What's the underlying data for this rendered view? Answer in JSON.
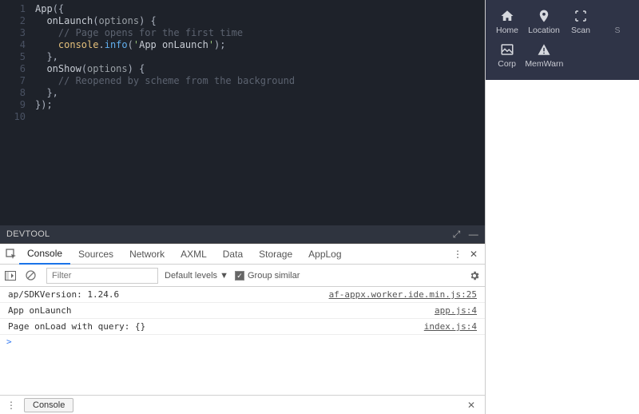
{
  "editor": {
    "lines": [
      "App({",
      "  onLaunch(options) {",
      "    // Page opens for the first time",
      "    console.info('App onLaunch');",
      "  },",
      "  onShow(options) {",
      "    // Reopened by scheme from the background",
      "  },",
      "});"
    ],
    "line_numbers": [
      "1",
      "2",
      "3",
      "4",
      "5",
      "6",
      "7",
      "8",
      "9",
      "10"
    ]
  },
  "devtool": {
    "title": "DEVTOOL",
    "tabs": [
      "Console",
      "Sources",
      "Network",
      "AXML",
      "Data",
      "Storage",
      "AppLog"
    ],
    "active_tab": "Console",
    "filter_placeholder": "Filter",
    "levels_label": "Default levels ▼",
    "group_similar_label": "Group similar",
    "logs": [
      {
        "msg": "ap/SDKVersion: 1.24.6",
        "src": "af-appx.worker.ide.min.js:25"
      },
      {
        "msg": "App onLaunch",
        "src": "app.js:4"
      },
      {
        "msg": "Page onLoad with query: {}",
        "src": "index.js:4"
      }
    ],
    "prompt": ">",
    "footer_tab": "Console"
  },
  "sim": {
    "row1": [
      {
        "name": "home",
        "label": "Home"
      },
      {
        "name": "location",
        "label": "Location"
      },
      {
        "name": "scan",
        "label": "Scan"
      },
      {
        "name": "more",
        "label": "S"
      }
    ],
    "row2": [
      {
        "name": "corp",
        "label": "Corp"
      },
      {
        "name": "memwarn",
        "label": "MemWarn"
      }
    ]
  }
}
